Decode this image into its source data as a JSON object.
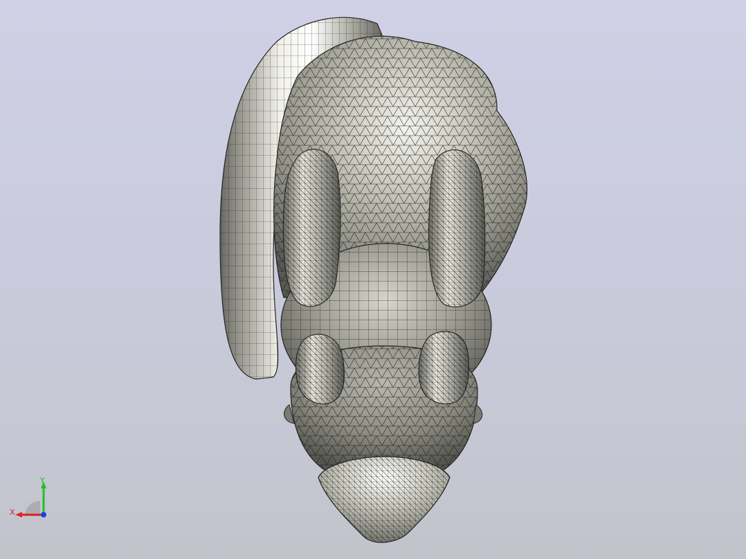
{
  "viewport": {
    "background_top": "#d0d0e6",
    "background_bottom": "#c2c4cc",
    "model_name": "",
    "render_mode": "shaded-with-mesh-edges",
    "mesh_color": "#1a1a1a",
    "surface_color": "#8a8a80"
  },
  "triad": {
    "x_label": "X",
    "y_label": "Y",
    "x_color": "#e02020",
    "y_color": "#20c020",
    "z_color": "#2040e0"
  }
}
